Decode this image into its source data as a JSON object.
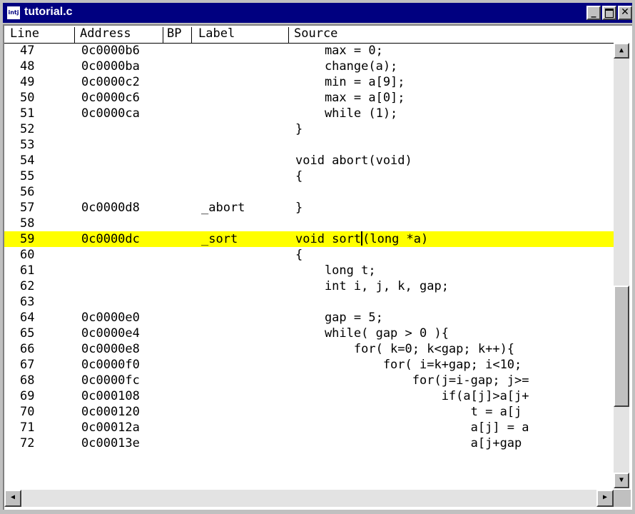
{
  "window": {
    "title": "tutorial.c",
    "app_icon": "intj-icon",
    "app_icon_text": "intj"
  },
  "columns": [
    "Line",
    "Address",
    "BP",
    "Label",
    "Source"
  ],
  "rows": [
    {
      "line": "47",
      "address": "0c0000b6",
      "label": "",
      "source": "    max = 0;"
    },
    {
      "line": "48",
      "address": "0c0000ba",
      "label": "",
      "source": "    change(a);"
    },
    {
      "line": "49",
      "address": "0c0000c2",
      "label": "",
      "source": "    min = a[9];"
    },
    {
      "line": "50",
      "address": "0c0000c6",
      "label": "",
      "source": "    max = a[0];"
    },
    {
      "line": "51",
      "address": "0c0000ca",
      "label": "",
      "source": "    while (1);"
    },
    {
      "line": "52",
      "address": "",
      "label": "",
      "source": "}"
    },
    {
      "line": "53",
      "address": "",
      "label": "",
      "source": ""
    },
    {
      "line": "54",
      "address": "",
      "label": "",
      "source": "void abort(void)"
    },
    {
      "line": "55",
      "address": "",
      "label": "",
      "source": "{"
    },
    {
      "line": "56",
      "address": "",
      "label": "",
      "source": ""
    },
    {
      "line": "57",
      "address": "0c0000d8",
      "label": "_abort",
      "source": "}"
    },
    {
      "line": "58",
      "address": "",
      "label": "",
      "source": ""
    },
    {
      "line": "59",
      "address": "0c0000dc",
      "label": "_sort",
      "source": "void sort(long *a)",
      "highlighted": true
    },
    {
      "line": "60",
      "address": "",
      "label": "",
      "source": "{"
    },
    {
      "line": "61",
      "address": "",
      "label": "",
      "source": "    long t;"
    },
    {
      "line": "62",
      "address": "",
      "label": "",
      "source": "    int i, j, k, gap;"
    },
    {
      "line": "63",
      "address": "",
      "label": "",
      "source": ""
    },
    {
      "line": "64",
      "address": "0c0000e0",
      "label": "",
      "source": "    gap = 5;"
    },
    {
      "line": "65",
      "address": "0c0000e4",
      "label": "",
      "source": "    while( gap > 0 ){"
    },
    {
      "line": "66",
      "address": "0c0000e8",
      "label": "",
      "source": "        for( k=0; k<gap; k++){"
    },
    {
      "line": "67",
      "address": "0c0000f0",
      "label": "",
      "source": "            for( i=k+gap; i<10;"
    },
    {
      "line": "68",
      "address": "0c0000fc",
      "label": "",
      "source": "                for(j=i-gap; j>="
    },
    {
      "line": "69",
      "address": "0c000108",
      "label": "",
      "source": "                    if(a[j]>a[j+"
    },
    {
      "line": "70",
      "address": "0c000120",
      "label": "",
      "source": "                        t = a[j"
    },
    {
      "line": "71",
      "address": "0c00012a",
      "label": "",
      "source": "                        a[j] = a"
    },
    {
      "line": "72",
      "address": "0c00013e",
      "label": "",
      "source": "                        a[j+gap"
    }
  ],
  "caret": {
    "row_line": "59",
    "after_text": "void sort",
    "rest_text": "(long *a)"
  },
  "colors": {
    "highlight": "#ffff00",
    "titlebar": "#000080"
  },
  "icons": {
    "minimize": "minimize-icon",
    "maximize": "maximize-icon",
    "close": "close-icon",
    "scroll_up": "arrow-up-icon",
    "scroll_down": "arrow-down-icon",
    "scroll_left": "arrow-left-icon",
    "scroll_right": "arrow-right-icon"
  },
  "glyphs": {
    "close": "✕",
    "up": "▲",
    "down": "▼",
    "left": "◀",
    "right": "▶",
    "min": "_"
  }
}
